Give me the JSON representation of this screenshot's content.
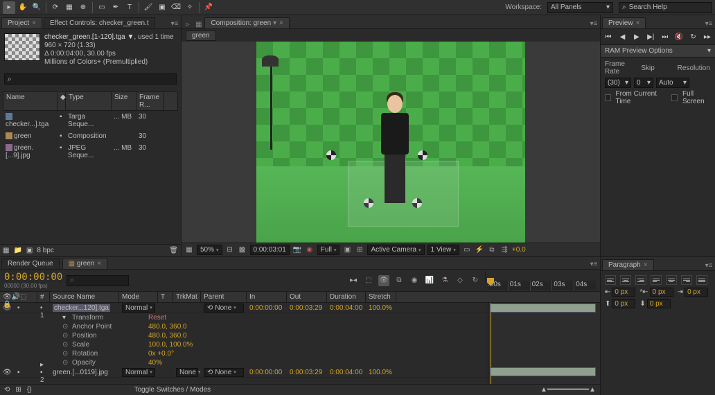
{
  "toolbar": {
    "workspace_label": "Workspace:",
    "workspace_value": "All Panels",
    "search_placeholder": "Search Help"
  },
  "project": {
    "tab": "Project",
    "tab2": "Effect Controls: checker_green.t",
    "file_title": "checker_green.[1-120].tga ▼",
    "file_used": ", used 1 time",
    "res": "960 × 720 (1.33)",
    "dur": "Δ 0:00:04:00, 30.00 fps",
    "colors": "Millions of Colors+ (Premultiplied)",
    "search_placeholder": "⌕",
    "cols": {
      "name": "Name",
      "type": "Type",
      "size": "Size",
      "fr": "Frame R..."
    },
    "items": [
      {
        "name": "checker...].tga",
        "type": "Targa Seque...",
        "size": "... MB",
        "fr": "30",
        "ico": "img"
      },
      {
        "name": "green",
        "type": "Composition",
        "size": "",
        "fr": "30",
        "ico": "comp"
      },
      {
        "name": "green.[...9].jpg",
        "type": "JPEG Seque...",
        "size": "... MB",
        "fr": "30",
        "ico": "jpg"
      }
    ],
    "bpc": "8 bpc"
  },
  "comp": {
    "tab_label": "Composition: green",
    "chip": "green",
    "footer": {
      "zoom": "50%",
      "time": "0:00:03:01",
      "res": "Full",
      "camera": "Active Camera",
      "view": "1 View",
      "exposure": "+0.0"
    }
  },
  "preview": {
    "tab": "Preview",
    "ram_hdr": "RAM Preview Options",
    "labels": {
      "fr": "Frame Rate",
      "skip": "Skip",
      "res": "Resolution"
    },
    "vals": {
      "fr": "(30)",
      "skip": "0",
      "res": "Auto"
    },
    "chk1": "From Current Time",
    "chk2": "Full Screen"
  },
  "timeline": {
    "tab1": "Render Queue",
    "tab2": "green",
    "timecode": "0:00:00:00",
    "timecode_sub": "00000 (30.00 fps)",
    "ruler": [
      ":00s",
      "01s",
      "02s",
      "03s",
      "04s"
    ],
    "cols": {
      "src": "Source Name",
      "mode": "Mode",
      "t": "T",
      "trk": "TrkMat",
      "par": "Parent",
      "in": "In",
      "out": "Out",
      "dur": "Duration",
      "str": "Stretch"
    },
    "layers": [
      {
        "num": "1",
        "name": "checker...120].tga",
        "mode": "Normal",
        "par": "None",
        "in": "0:00:00:00",
        "out": "0:00:03:29",
        "dur": "0:00:04:00",
        "str": "100.0%"
      },
      {
        "num": "2",
        "name": "green.[...0119].jpg",
        "mode": "Normal",
        "par": "None",
        "in": "0:00:00:00",
        "out": "0:00:03:29",
        "dur": "0:00:04:00",
        "str": "100.0%"
      }
    ],
    "transform": "Transform",
    "reset": "Reset",
    "props": [
      {
        "k": "Anchor Point",
        "v": "480.0, 360.0"
      },
      {
        "k": "Position",
        "v": "480.0, 360.0"
      },
      {
        "k": "Scale",
        "v": "100.0, 100.0%"
      },
      {
        "k": "Rotation",
        "v": "0x +0.0°"
      },
      {
        "k": "Opacity",
        "v": "40%"
      }
    ],
    "toggle": "Toggle Switches / Modes"
  },
  "paragraph": {
    "tab": "Paragraph",
    "indent": "0 px"
  }
}
